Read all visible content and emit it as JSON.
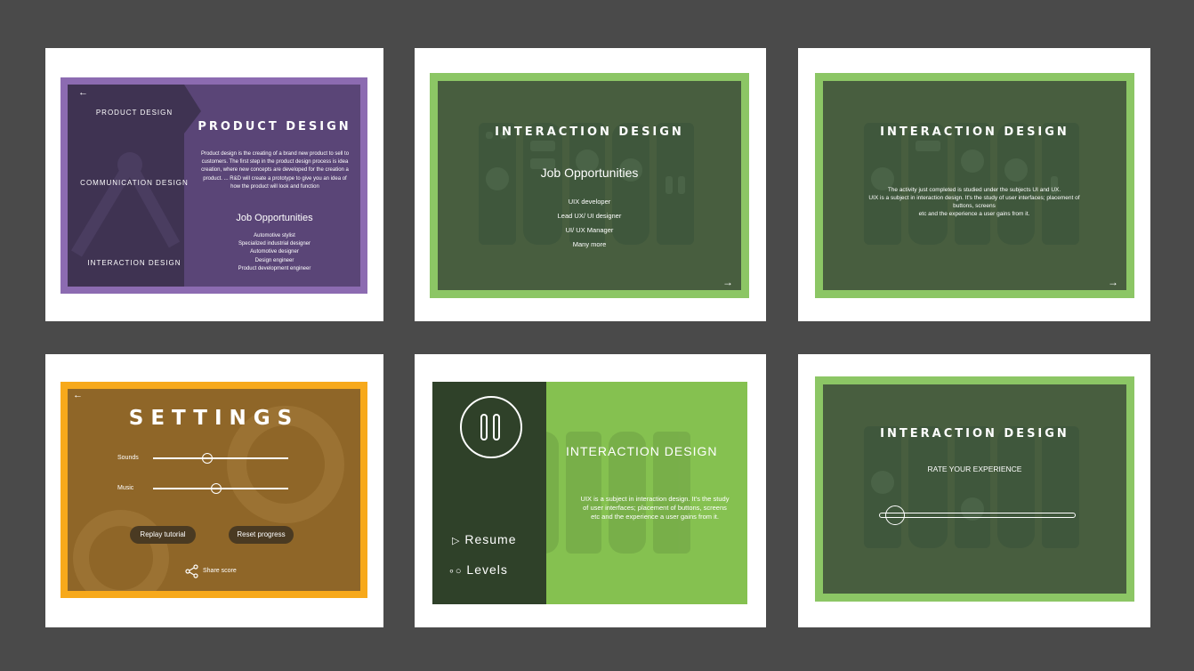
{
  "colors": {
    "background": "#4a4a4a",
    "purple": "#8c6bb1",
    "purple_dark": "#5a4577",
    "green": "#8cc665",
    "green_dark": "#485e3f",
    "orange": "#f7a91b",
    "brown": "#8f6628"
  },
  "screen1": {
    "nav": [
      "PRODUCT DESIGN",
      "COMMUNICATION DESIGN",
      "INTERACTION DESIGN"
    ],
    "title": "PRODUCT DESIGN",
    "description": "Product design is the creating of a brand new product to sell to customers. The first step in the product design process is idea creation, where new concepts are developed for the creation a product. ... R&D will create a prototype to give you an idea of how the product will look and function",
    "jobs_heading": "Job Opportunities",
    "jobs": [
      "Automotive stylist",
      "Specialized industrial designer",
      "Automotive designer",
      "Design engineer",
      "Product development engineer"
    ]
  },
  "screen2": {
    "title": "INTERACTION DESIGN",
    "jobs_heading": "Job Opportunities",
    "jobs": [
      "UIX developer",
      "Lead UX/ UI designer",
      "UI/ UX Manager",
      "Many more"
    ]
  },
  "screen3": {
    "title": "INTERACTION DESIGN",
    "lines": [
      "The activity just completed is studied under the subjects UI and UX.",
      "UIX is a subject in interaction design. It's the study of user interfaces; placement of buttons, screens",
      "etc and the experience a user gains from it."
    ]
  },
  "screen4": {
    "title": "SETTINGS",
    "sounds_label": "Sounds",
    "music_label": "Music",
    "sounds_level": 0.4,
    "music_level": 0.47,
    "replay_label": "Replay tutorial",
    "reset_label": "Reset progress",
    "share_label": "Share score"
  },
  "screen5": {
    "title": "INTERACTION DESIGN",
    "lines": [
      "UIX is a subject in interaction design. It's the study of user interfaces; placement of buttons, screens",
      "etc and the experience a user gains from it."
    ],
    "resume_label": "Resume",
    "levels_label": "Levels"
  },
  "screen6": {
    "title": "INTERACTION DESIGN",
    "rate_label": "RATE YOUR EXPERIENCE",
    "rating_level": 0.08
  }
}
